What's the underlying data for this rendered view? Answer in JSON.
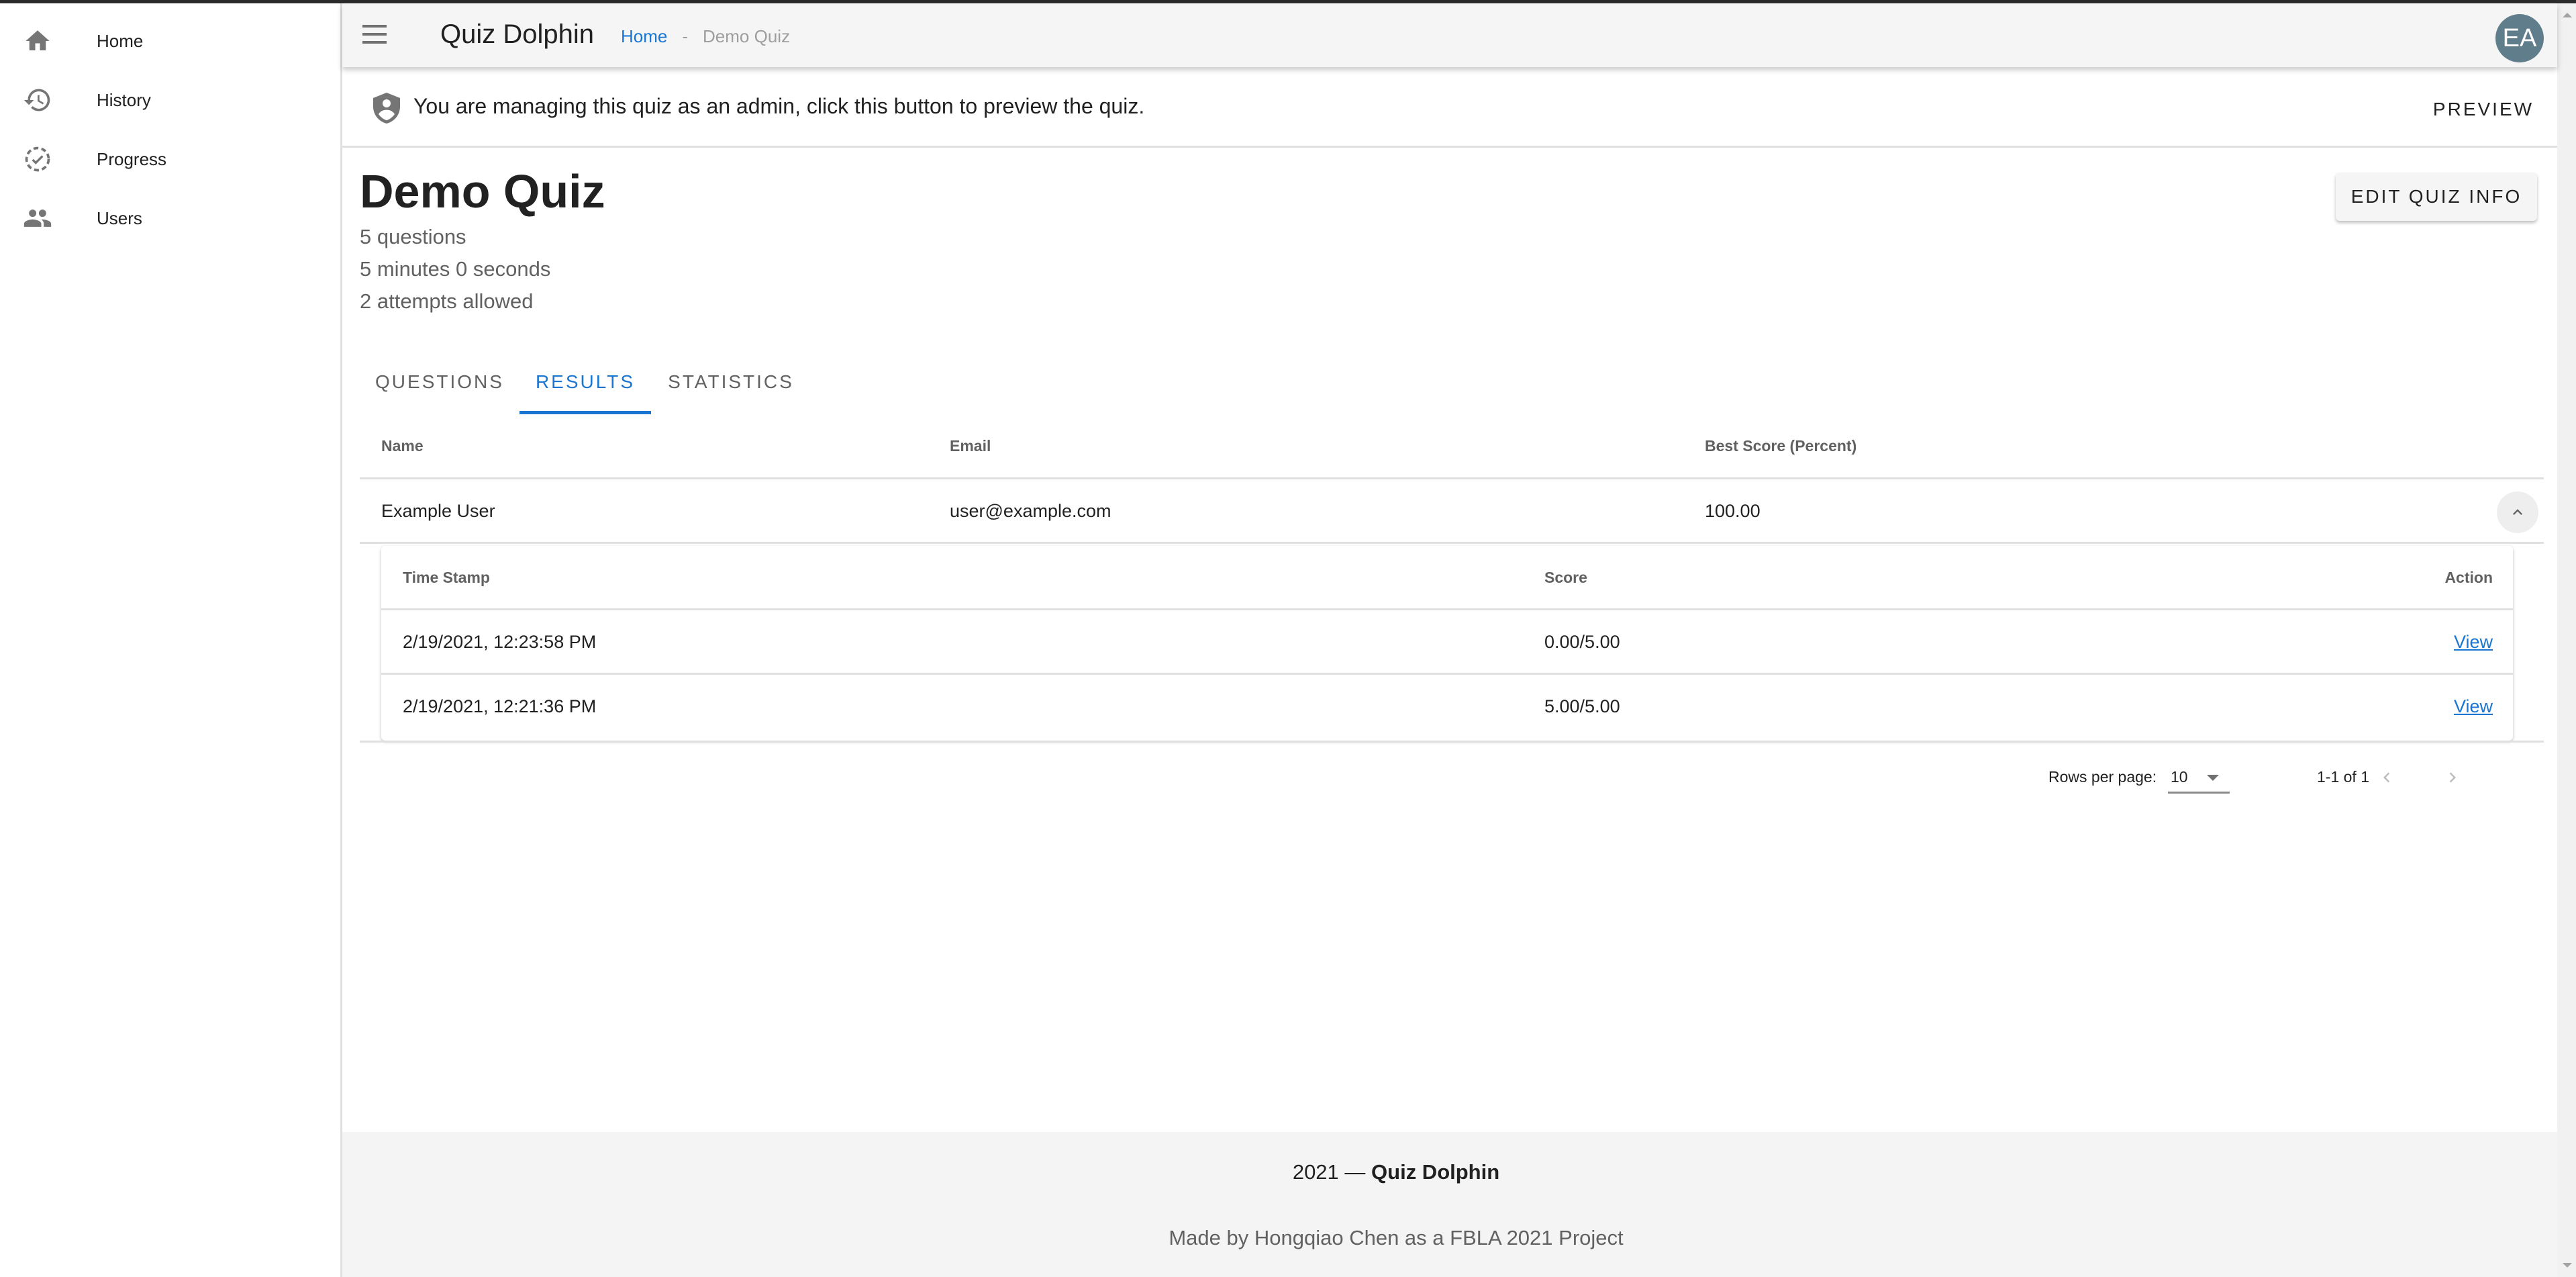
{
  "app": {
    "title": "Quiz Dolphin",
    "avatar_initials": "EA",
    "avatar_color": "#607d8b",
    "accent_color": "#1976d2"
  },
  "sidebar": {
    "items": [
      {
        "label": "Home",
        "icon": "home-icon"
      },
      {
        "label": "History",
        "icon": "history-icon"
      },
      {
        "label": "Progress",
        "icon": "progress-icon"
      },
      {
        "label": "Users",
        "icon": "users-icon"
      }
    ]
  },
  "breadcrumb": {
    "home": "Home",
    "separator": "-",
    "current": "Demo Quiz"
  },
  "banner": {
    "icon": "admin-shield-icon",
    "text": "You are managing this quiz as an admin, click this button to preview the quiz.",
    "preview_label": "PREVIEW"
  },
  "quiz": {
    "title": "Demo Quiz",
    "questions": "5 questions",
    "time": "5 minutes 0 seconds",
    "attempts": "2 attempts allowed",
    "edit_label": "EDIT QUIZ INFO"
  },
  "tabs": [
    {
      "label": "QUESTIONS",
      "active": false
    },
    {
      "label": "RESULTS",
      "active": true
    },
    {
      "label": "STATISTICS",
      "active": false
    }
  ],
  "results": {
    "columns": [
      "Name",
      "Email",
      "Best Score (Percent)"
    ],
    "rows": [
      {
        "name": "Example User",
        "email": "user@example.com",
        "best_score": "100.00",
        "expanded": true,
        "attempts": {
          "columns": [
            "Time Stamp",
            "Score",
            "Action"
          ],
          "rows": [
            {
              "timestamp": "2/19/2021, 12:23:58 PM",
              "score": "0.00/5.00",
              "action": "View"
            },
            {
              "timestamp": "2/19/2021, 12:21:36 PM",
              "score": "5.00/5.00",
              "action": "View"
            }
          ]
        }
      }
    ]
  },
  "pagination": {
    "rows_per_page_label": "Rows per page:",
    "rows_per_page": "10",
    "range": "1-1 of 1"
  },
  "footer": {
    "year": "2021 —",
    "brand": "Quiz Dolphin",
    "credit": "Made by Hongqiao Chen as a FBLA 2021 Project"
  }
}
